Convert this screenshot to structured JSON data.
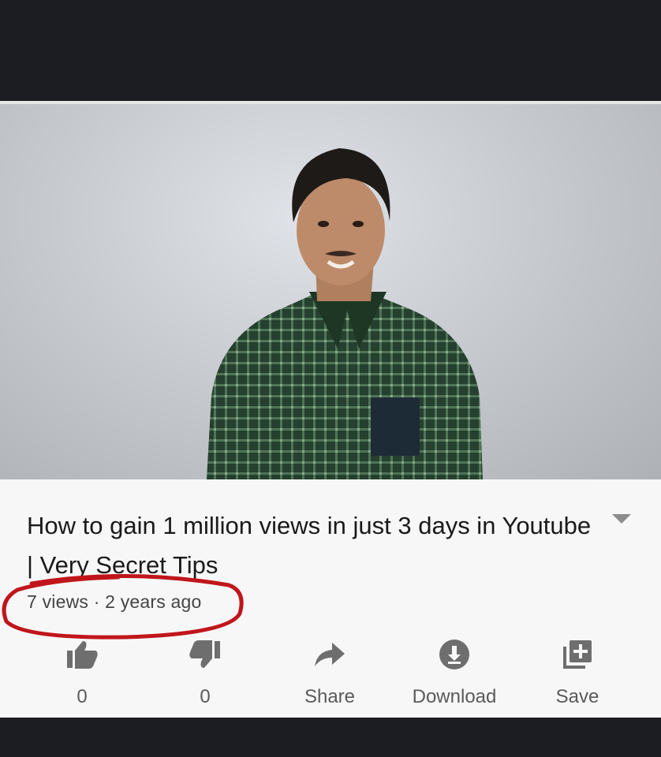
{
  "video": {
    "title": "How to gain 1 million views in just 3 days in Youtube | Very Secret Tips",
    "views": "7 views",
    "separator": "·",
    "age": "2 years ago"
  },
  "actions": [
    {
      "icon": "thumbs-up-icon",
      "label": "0"
    },
    {
      "icon": "thumbs-down-icon",
      "label": "0"
    },
    {
      "icon": "share-icon",
      "label": "Share"
    },
    {
      "icon": "download-icon",
      "label": "Download"
    },
    {
      "icon": "add-to-playlist-icon",
      "label": "Save"
    }
  ],
  "colors": {
    "annotation": "#c0161b",
    "icon": "#6e6e6e",
    "background": "#f7f7f7"
  }
}
